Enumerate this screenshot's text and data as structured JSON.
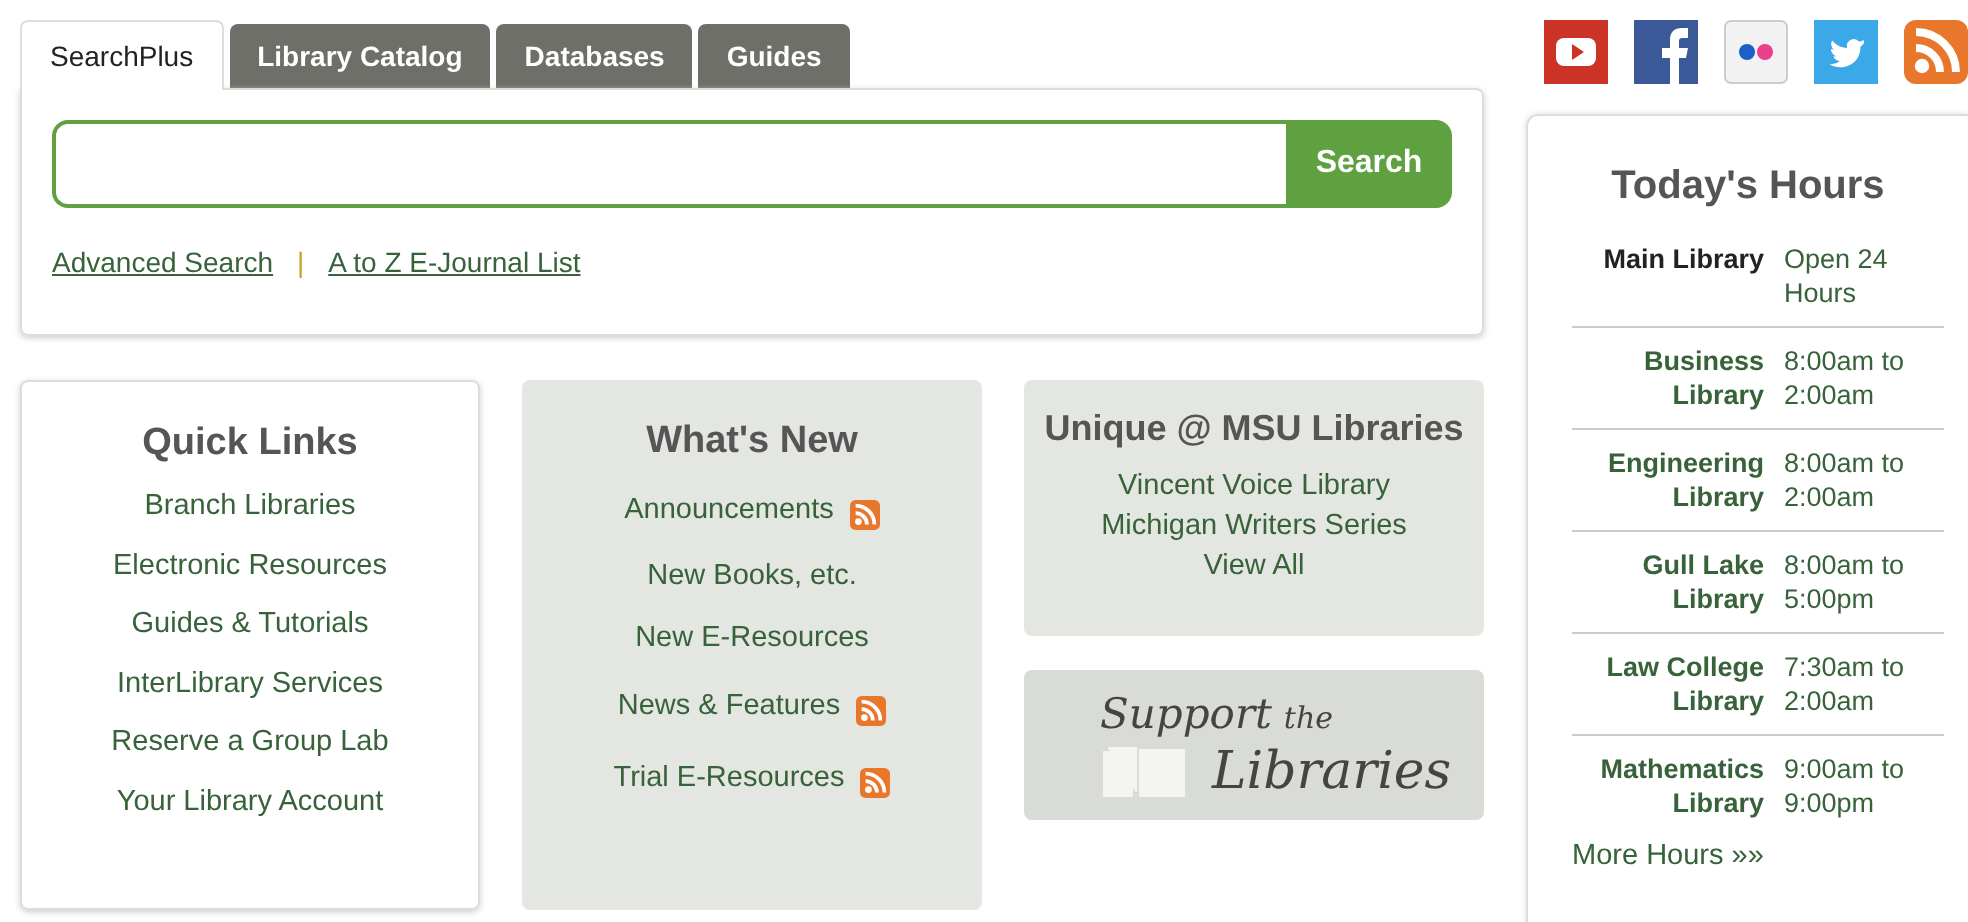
{
  "search_tabs": [
    {
      "label": "SearchPlus",
      "selected": true
    },
    {
      "label": "Library Catalog",
      "selected": false
    },
    {
      "label": "Databases",
      "selected": false
    },
    {
      "label": "Guides",
      "selected": false
    }
  ],
  "search": {
    "button": "Search",
    "links": [
      "Advanced Search",
      "A to Z E-Journal List"
    ],
    "separator": "|"
  },
  "quick_links": {
    "title": "Quick Links",
    "items": [
      "Branch Libraries",
      "Electronic Resources",
      "Guides & Tutorials",
      "InterLibrary Services",
      "Reserve a Group Lab",
      "Your Library Account"
    ]
  },
  "whats_new": {
    "title": "What's New",
    "items": [
      {
        "label": "Announcements",
        "rss": true
      },
      {
        "label": "New Books, etc.",
        "rss": false
      },
      {
        "label": "New E-Resources",
        "rss": false
      },
      {
        "label": "News & Features",
        "rss": true
      },
      {
        "label": "Trial E-Resources",
        "rss": true
      }
    ]
  },
  "unique": {
    "title": "Unique @ MSU Libraries",
    "items": [
      "Vincent Voice Library",
      "Michigan Writers Series",
      "View All"
    ]
  },
  "support_banner": {
    "line_1": "Support",
    "line_1_small": "the",
    "line_2": "Libraries"
  },
  "hours": {
    "title": "Today's Hours",
    "rows": [
      {
        "kind": "text",
        "name": "Main Library",
        "time": "Open 24 Hours"
      },
      {
        "kind": "link",
        "name": "Business Library",
        "time": "8:00am to 2:00am"
      },
      {
        "kind": "link",
        "name": "Engineering Library",
        "time": "8:00am to 2:00am"
      },
      {
        "kind": "link",
        "name": "Gull Lake Library",
        "time": "8:00am to 5:00pm"
      },
      {
        "kind": "link",
        "name": "Law College Library",
        "time": "7:30am to 2:00am"
      },
      {
        "kind": "link",
        "name": "Mathematics Library",
        "time": "9:00am to 9:00pm"
      }
    ],
    "more": "More Hours »»"
  }
}
